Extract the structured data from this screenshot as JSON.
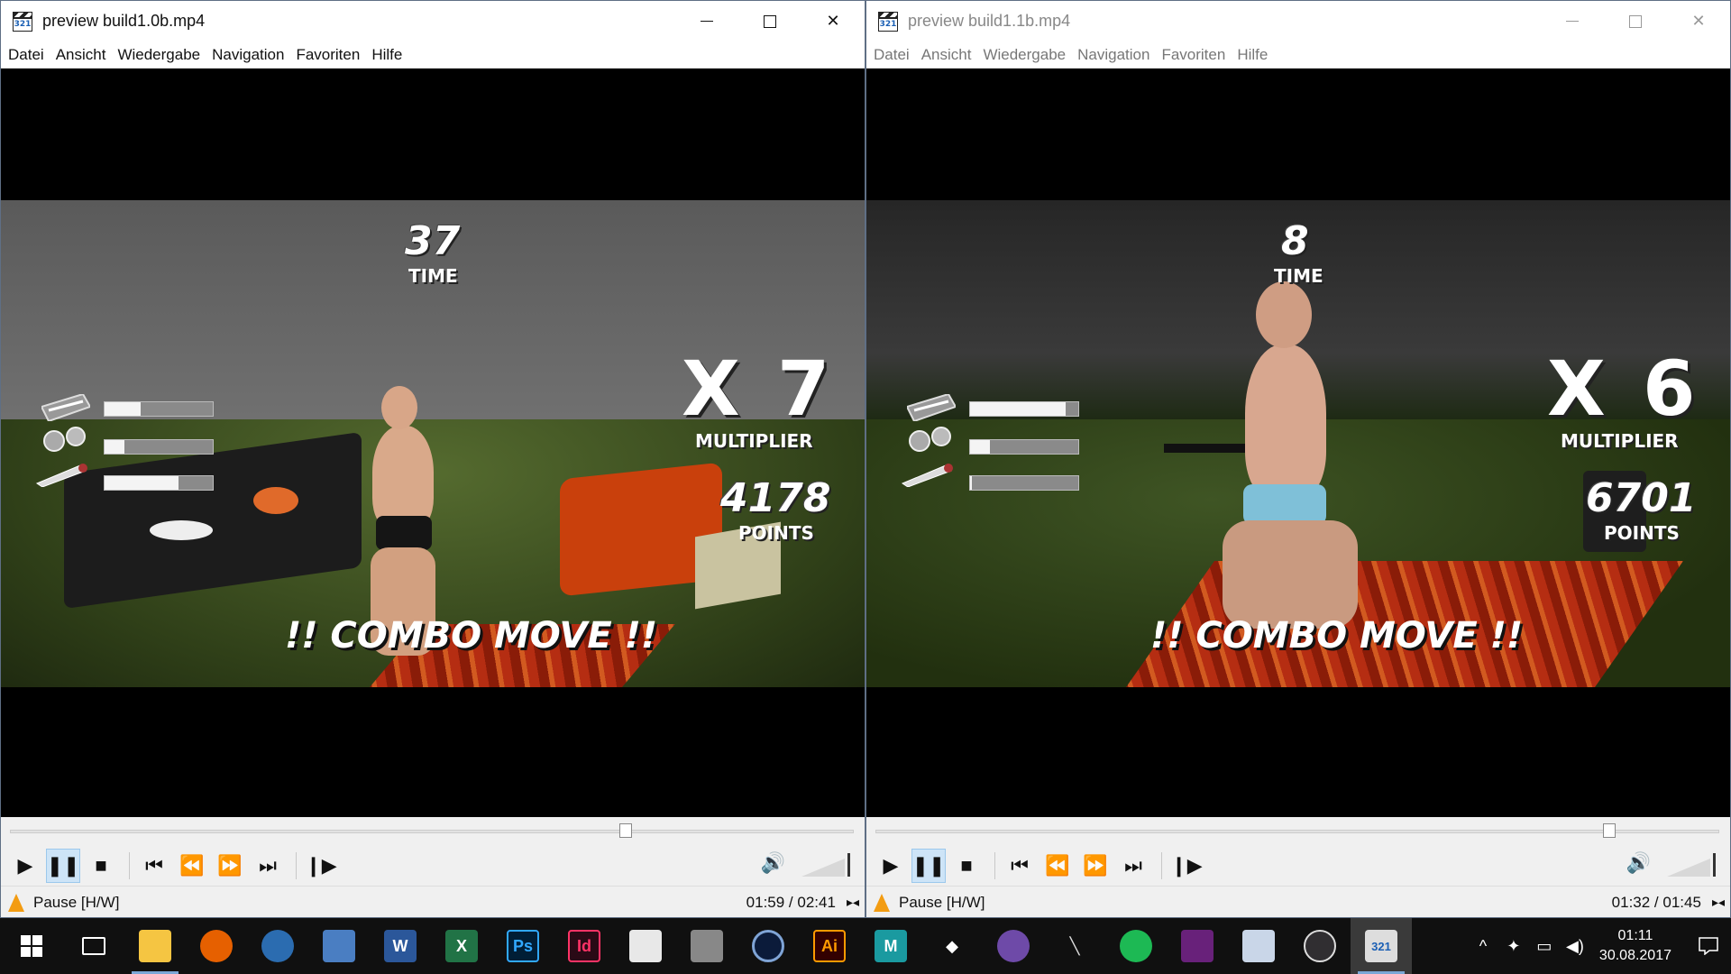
{
  "windows": [
    {
      "title": "preview build1.0b.mp4",
      "menu": [
        "Datei",
        "Ansicht",
        "Wiedergabe",
        "Navigation",
        "Favoriten",
        "Hilfe"
      ],
      "hud": {
        "time_value": "37",
        "time_label": "TIME",
        "multiplier_value": "X 7",
        "multiplier_label": "MULTIPLIER",
        "points_value": "4178",
        "points_label": "POINTS",
        "combo": "!! COMBO MOVE !!",
        "bars": [
          0.33,
          0.18,
          0.68
        ]
      },
      "seek_fraction": 0.73,
      "status_text": "Pause [H/W]",
      "status_time": "01:59 / 02:41"
    },
    {
      "title": "preview build1.1b.mp4",
      "menu": [
        "Datei",
        "Ansicht",
        "Wiedergabe",
        "Navigation",
        "Favoriten",
        "Hilfe"
      ],
      "hud": {
        "time_value": "8",
        "time_label": "TIME",
        "multiplier_value": "X 6",
        "multiplier_label": "MULTIPLIER",
        "points_value": "6701",
        "points_label": "POINTS",
        "combo": "!! COMBO MOVE !!",
        "bars": [
          0.88,
          0.18,
          0.02
        ]
      },
      "seek_fraction": 0.87,
      "status_text": "Pause [H/W]",
      "status_time": "01:32 / 01:45"
    }
  ],
  "controls_icons": [
    "play-icon",
    "pause-icon",
    "stop-icon",
    "previous-icon",
    "rewind-icon",
    "fast-forward-icon",
    "next-icon",
    "frame-step-icon"
  ],
  "taskbar": {
    "apps": [
      "start",
      "task-view",
      "file-explorer",
      "firefox",
      "thunderbird",
      "remote-desktop",
      "word",
      "excel",
      "photoshop",
      "indesign",
      "paint",
      "app-grey",
      "cinema4d",
      "illustrator",
      "maya",
      "unity",
      "github",
      "pen-tool",
      "spotify",
      "visual-studio",
      "preview-app",
      "obs",
      "mpc-player"
    ],
    "clock_time": "01:11",
    "clock_date": "30.08.2017"
  },
  "colors": {
    "accent": "#7aa7d6",
    "vlc_cone": "#f39c12",
    "active_button": "#cde4f7"
  }
}
